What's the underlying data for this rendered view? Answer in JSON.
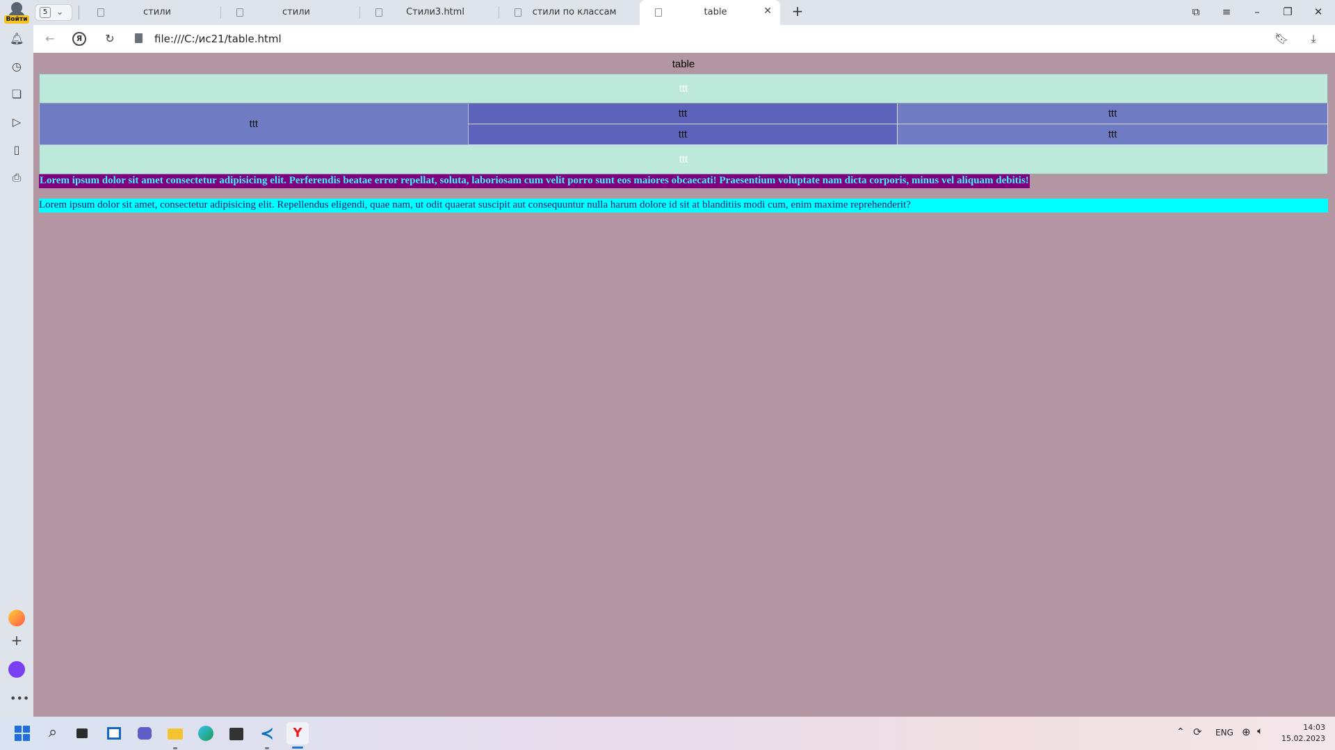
{
  "browser": {
    "profile_label": "Войти",
    "tab_count": "5",
    "tabs": [
      {
        "label": "стили"
      },
      {
        "label": "стили"
      },
      {
        "label": "Стили3.html"
      },
      {
        "label": "стили по классам"
      },
      {
        "label": "table"
      }
    ],
    "active_tab_index": 4,
    "url": "file:///C:/ис21/table.html"
  },
  "page": {
    "caption": "table",
    "table": {
      "header": "ttt",
      "left": "ttt",
      "row1": [
        "ttt",
        "ttt"
      ],
      "row2": [
        "ttt",
        "ttt"
      ],
      "footer": "ttt"
    },
    "bold_paragraph": "Lorem ipsum dolor sit amet consectetur adipisicing elit. Perferendis beatae error repellat, soluta, laboriosam cum velit porro sunt eos maiores obcaecati! Praesentium voluptate nam dicta corporis, minus vel aliquam debitis!",
    "plain_paragraph": "Lorem ipsum dolor sit amet, consectetur adipisicing elit. Repellendus eligendi, quae nam, ut odit quaerat suscipit aut consequuntur nulla harum dolore id sit at blanditiis modi cum, enim maxime reprehenderit?"
  },
  "taskbar": {
    "lang": "ENG",
    "time": "14:03",
    "date": "15.02.2023"
  },
  "colors": {
    "page_bg": "#b297a3",
    "table_head": "#bde9db",
    "table_blue": "#6f7cc3",
    "table_mid": "#5d63bb",
    "bold_bg": "#800080",
    "bold_text": "#3ef3ff",
    "plain_bg": "#00ffff"
  }
}
